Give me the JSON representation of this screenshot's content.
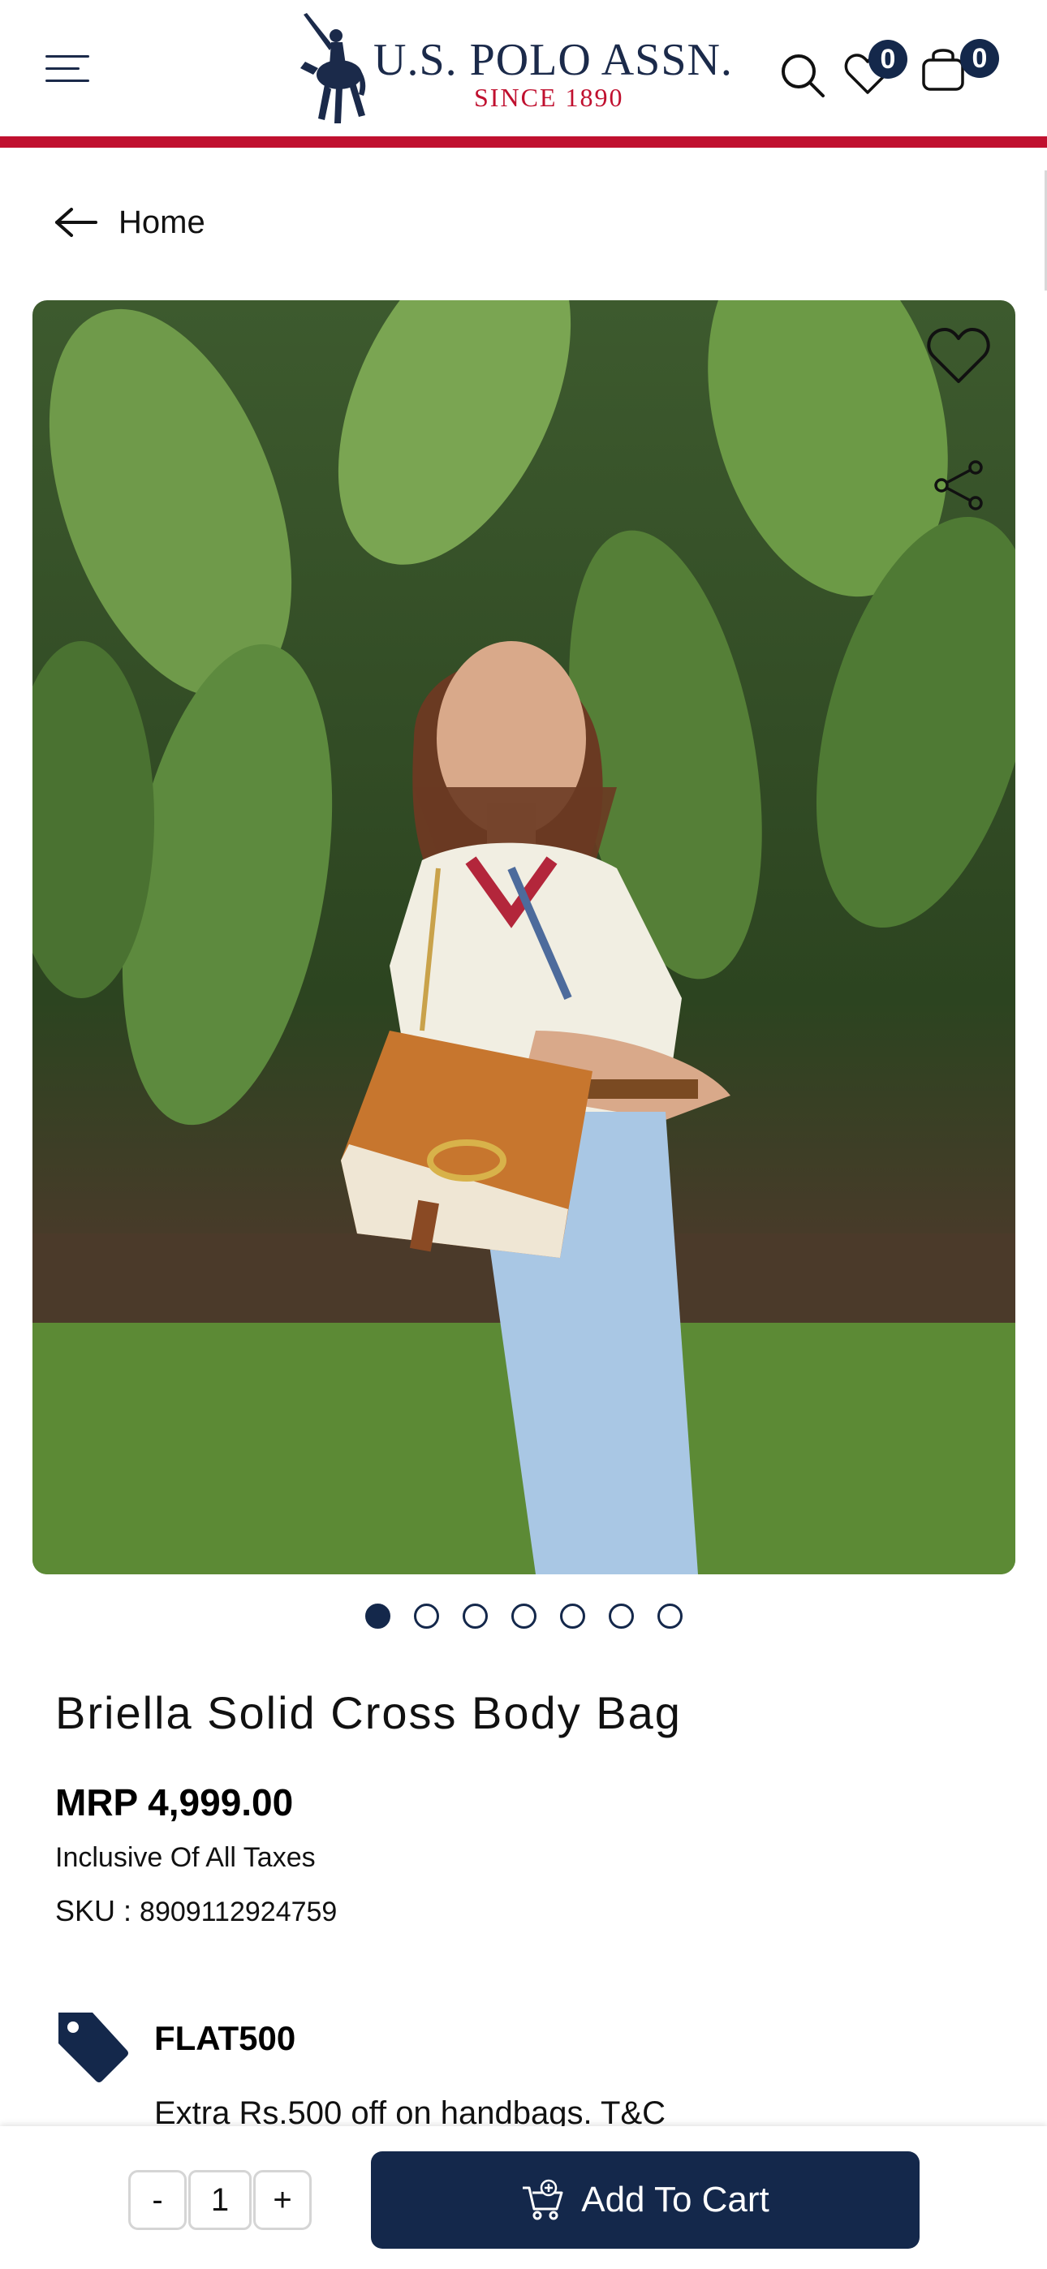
{
  "header": {
    "brand": "U.S. POLO ASSN.",
    "brand_sub": "SINCE 1890",
    "wishlist_count": "0",
    "cart_count": "0",
    "icons": [
      "menu-icon",
      "search-icon",
      "heart-icon",
      "shopping-bag-icon"
    ],
    "accent_color": "#c0102f",
    "brand_color": "#14284b"
  },
  "breadcrumb": {
    "back_label": "Home"
  },
  "gallery": {
    "image_count": 7,
    "active_index": 0
  },
  "product": {
    "title": "Briella Solid Cross Body Bag",
    "price": "MRP 4,999.00",
    "tax_note": "Inclusive Of All Taxes",
    "sku_label": "SKU : ",
    "sku_value": "8909112924759"
  },
  "offer": {
    "code": "FLAT500",
    "description": "Extra Rs.500 off on handbags. T&C"
  },
  "cart_bar": {
    "minus": "-",
    "quantity": "1",
    "plus": "+",
    "add_to_cart": "Add To Cart"
  }
}
